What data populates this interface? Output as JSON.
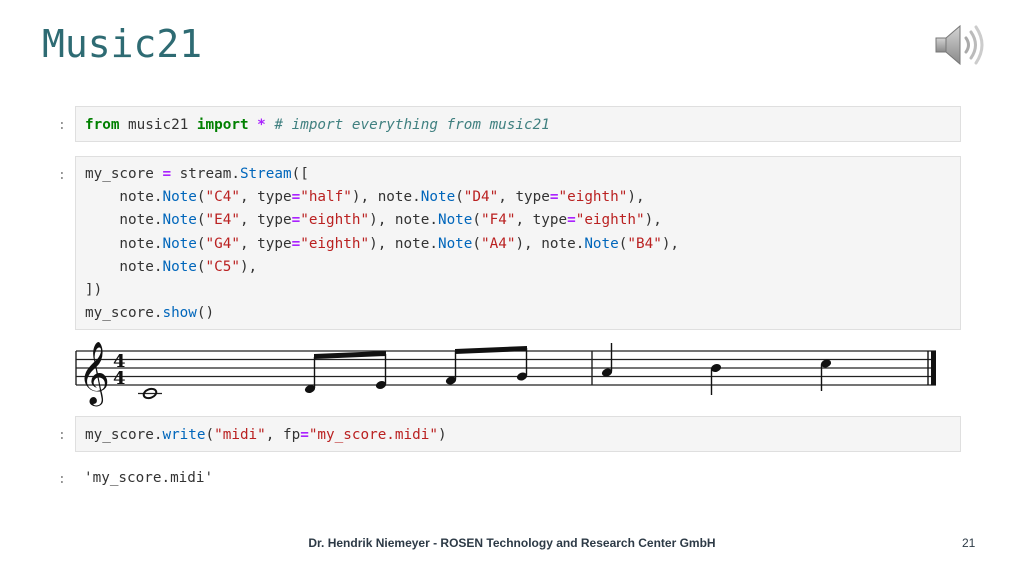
{
  "slide": {
    "title": "Music21",
    "footer": "Dr. Hendrik Niemeyer - ROSEN Technology and Research Center GmbH",
    "page_number": "21",
    "audio_icon": "speaker-icon"
  },
  "cells": [
    {
      "prompt": ":",
      "tokens": [
        {
          "t": "from",
          "c": "kw"
        },
        {
          "t": " music21 ",
          "c": "pu"
        },
        {
          "t": "import",
          "c": "kw"
        },
        {
          "t": " ",
          "c": "pu"
        },
        {
          "t": "*",
          "c": "op"
        },
        {
          "t": " ",
          "c": "pu"
        },
        {
          "t": "# import everything from music21",
          "c": "cm"
        }
      ]
    },
    {
      "prompt": ":",
      "tokens": [
        {
          "t": "my_score ",
          "c": "pu"
        },
        {
          "t": "=",
          "c": "op"
        },
        {
          "t": " stream.",
          "c": "pu"
        },
        {
          "t": "Stream",
          "c": "fn"
        },
        {
          "t": "([\n    note.",
          "c": "pu"
        },
        {
          "t": "Note",
          "c": "fn"
        },
        {
          "t": "(",
          "c": "pu"
        },
        {
          "t": "\"C4\"",
          "c": "st"
        },
        {
          "t": ", type",
          "c": "pu"
        },
        {
          "t": "=",
          "c": "op"
        },
        {
          "t": "\"half\"",
          "c": "st"
        },
        {
          "t": "), note.",
          "c": "pu"
        },
        {
          "t": "Note",
          "c": "fn"
        },
        {
          "t": "(",
          "c": "pu"
        },
        {
          "t": "\"D4\"",
          "c": "st"
        },
        {
          "t": ", type",
          "c": "pu"
        },
        {
          "t": "=",
          "c": "op"
        },
        {
          "t": "\"eighth\"",
          "c": "st"
        },
        {
          "t": "),\n    note.",
          "c": "pu"
        },
        {
          "t": "Note",
          "c": "fn"
        },
        {
          "t": "(",
          "c": "pu"
        },
        {
          "t": "\"E4\"",
          "c": "st"
        },
        {
          "t": ", type",
          "c": "pu"
        },
        {
          "t": "=",
          "c": "op"
        },
        {
          "t": "\"eighth\"",
          "c": "st"
        },
        {
          "t": "), note.",
          "c": "pu"
        },
        {
          "t": "Note",
          "c": "fn"
        },
        {
          "t": "(",
          "c": "pu"
        },
        {
          "t": "\"F4\"",
          "c": "st"
        },
        {
          "t": ", type",
          "c": "pu"
        },
        {
          "t": "=",
          "c": "op"
        },
        {
          "t": "\"eighth\"",
          "c": "st"
        },
        {
          "t": "),\n    note.",
          "c": "pu"
        },
        {
          "t": "Note",
          "c": "fn"
        },
        {
          "t": "(",
          "c": "pu"
        },
        {
          "t": "\"G4\"",
          "c": "st"
        },
        {
          "t": ", type",
          "c": "pu"
        },
        {
          "t": "=",
          "c": "op"
        },
        {
          "t": "\"eighth\"",
          "c": "st"
        },
        {
          "t": "), note.",
          "c": "pu"
        },
        {
          "t": "Note",
          "c": "fn"
        },
        {
          "t": "(",
          "c": "pu"
        },
        {
          "t": "\"A4\"",
          "c": "st"
        },
        {
          "t": "), note.",
          "c": "pu"
        },
        {
          "t": "Note",
          "c": "fn"
        },
        {
          "t": "(",
          "c": "pu"
        },
        {
          "t": "\"B4\"",
          "c": "st"
        },
        {
          "t": "),\n    note.",
          "c": "pu"
        },
        {
          "t": "Note",
          "c": "fn"
        },
        {
          "t": "(",
          "c": "pu"
        },
        {
          "t": "\"C5\"",
          "c": "st"
        },
        {
          "t": "),\n])\nmy_score.",
          "c": "pu"
        },
        {
          "t": "show",
          "c": "fn"
        },
        {
          "t": "()",
          "c": "pu"
        }
      ]
    },
    {
      "prompt": ":",
      "tokens": [
        {
          "t": "my_score.",
          "c": "pu"
        },
        {
          "t": "write",
          "c": "fn"
        },
        {
          "t": "(",
          "c": "pu"
        },
        {
          "t": "\"midi\"",
          "c": "st"
        },
        {
          "t": ", fp",
          "c": "pu"
        },
        {
          "t": "=",
          "c": "op"
        },
        {
          "t": "\"my_score.midi\"",
          "c": "st"
        },
        {
          "t": ")",
          "c": "pu"
        }
      ]
    }
  ],
  "output": {
    "prompt": ":",
    "text": "'my_score.midi'"
  },
  "score": {
    "clef": "treble",
    "time_signature": [
      "4",
      "4"
    ],
    "measures": [
      [
        "C4 half",
        "D4 eighth",
        "E4 eighth",
        "F4 eighth",
        "G4 eighth"
      ],
      [
        "A4 quarter",
        "B4 quarter",
        "C5 quarter"
      ]
    ],
    "staff_color": "#222222"
  }
}
